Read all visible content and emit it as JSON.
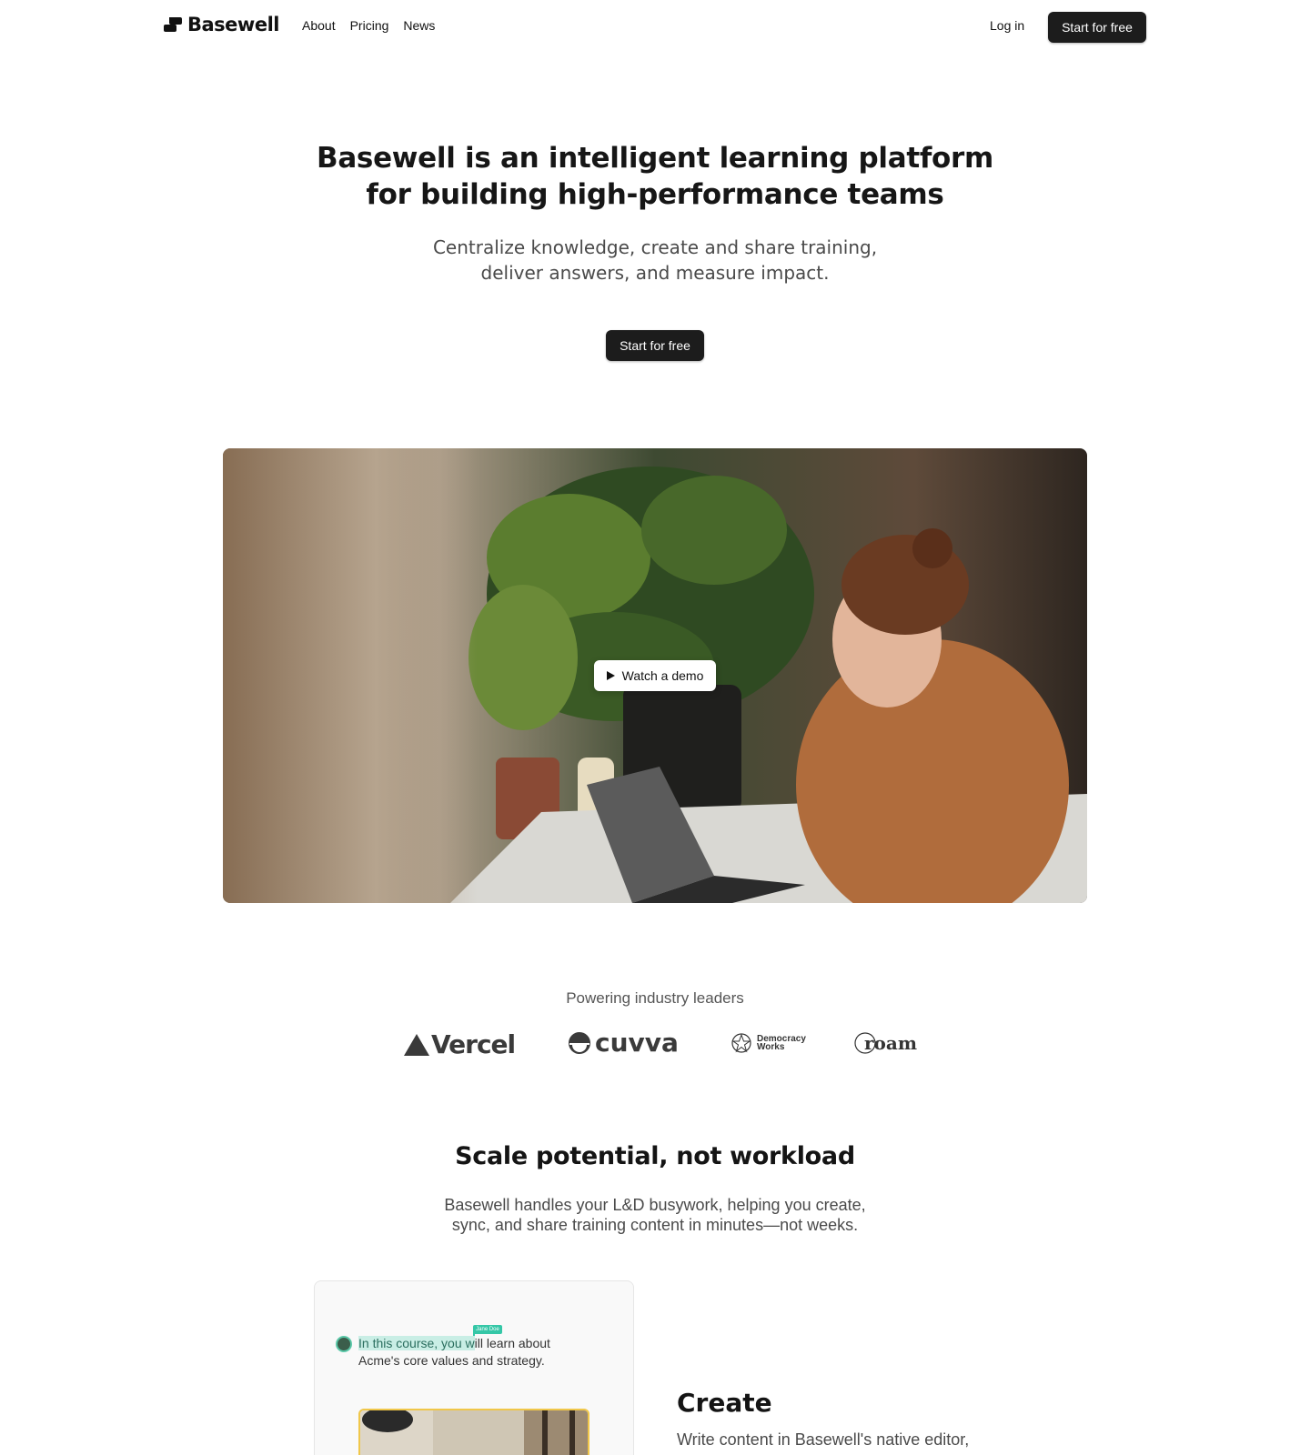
{
  "brand": {
    "name": "Basewell"
  },
  "nav": {
    "links": [
      "About",
      "Pricing",
      "News"
    ],
    "login_label": "Log in",
    "cta_label": "Start for free"
  },
  "hero": {
    "title_line1": "Basewell is an intelligent learning platform",
    "title_line2": "for building high-performance teams",
    "subtitle_line1": "Centralize knowledge, create and share training,",
    "subtitle_line2": "deliver answers, and measure impact.",
    "cta_label": "Start for free"
  },
  "video": {
    "watch_label": "Watch a demo"
  },
  "logos": {
    "heading": "Powering industry leaders",
    "vercel": "Vercel",
    "cuvva": "cuvva",
    "democracy_line1": "Democracy",
    "democracy_line2": "Works",
    "roam": "roam"
  },
  "features": {
    "title": "Scale potential, not workload",
    "subtitle_line1": "Basewell handles your L&D busywork, helping you create,",
    "subtitle_line2": "sync, and share training content in minutes—not weeks."
  },
  "editor_card": {
    "highlighted_text": "In this course, you w",
    "rest_text": "ill learn about",
    "line2": "Acme's core values and strategy.",
    "cursor_name": "Jane Doe"
  },
  "create": {
    "title": "Create",
    "description": "Write content in Basewell's native editor,"
  },
  "colors": {
    "button_dark": "#1c1c1c",
    "highlight": "#c9eee5",
    "cursor": "#35c7a7",
    "image_border": "#f0c74a"
  }
}
